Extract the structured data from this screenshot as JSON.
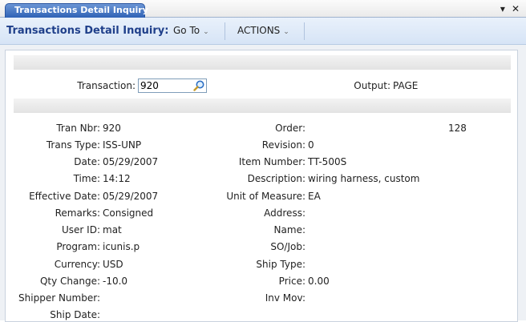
{
  "tab": {
    "title": "Transactions Detail Inquiry"
  },
  "window_controls": {
    "menu_icon": "▾",
    "close_icon": "✕"
  },
  "toolbar": {
    "title": "Transactions Detail Inquiry:",
    "goto_label": "Go To",
    "actions_label": "ACTIONS"
  },
  "header": {
    "transaction_label": "Transaction:",
    "transaction_value": "920",
    "output_label": "Output:",
    "output_value": "PAGE"
  },
  "left_fields": [
    {
      "label": "Tran Nbr:",
      "value": "920"
    },
    {
      "label": "Trans Type:",
      "value": "ISS-UNP"
    },
    {
      "label": "Date:",
      "value": "05/29/2007"
    },
    {
      "label": "Time:",
      "value": "14:12"
    },
    {
      "label": "Effective Date:",
      "value": "05/29/2007"
    },
    {
      "label": "Remarks:",
      "value": "Consigned"
    },
    {
      "label": "User ID:",
      "value": "mat"
    },
    {
      "label": "Program:",
      "value": "icunis.p"
    },
    {
      "label": "Currency:",
      "value": "USD"
    },
    {
      "label": "Qty Change:",
      "value": "-10.0"
    },
    {
      "label": "Shipper Number:",
      "value": ""
    },
    {
      "label": "Ship Date:",
      "value": ""
    }
  ],
  "right_fields": [
    {
      "label": "Order:",
      "value": ""
    },
    {
      "label": "Revision:",
      "value": "0"
    },
    {
      "label": "Item Number:",
      "value": "TT-500S"
    },
    {
      "label": "Description:",
      "value": "wiring harness, custom"
    },
    {
      "label": "Unit of Measure:",
      "value": "EA"
    },
    {
      "label": "Address:",
      "value": ""
    },
    {
      "label": "Name:",
      "value": ""
    },
    {
      "label": "SO/Job:",
      "value": ""
    },
    {
      "label": "Ship Type:",
      "value": ""
    },
    {
      "label": "Price:",
      "value": "0.00"
    },
    {
      "label": "Inv Mov:",
      "value": ""
    }
  ],
  "order_extra_value": "128",
  "icons": {
    "lookup": "magnifier-icon"
  }
}
